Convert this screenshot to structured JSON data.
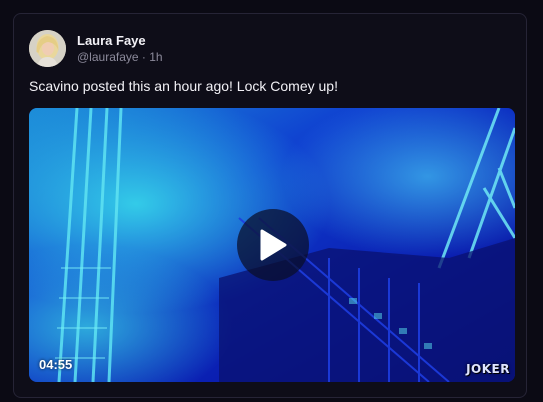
{
  "post": {
    "author": {
      "display_name": "Laura Faye",
      "handle": "@laurafaye",
      "separator": "·",
      "time": "1h"
    },
    "text": "Scavino posted this an hour ago! Lock Comey up!",
    "video": {
      "duration": "04:55",
      "watermark": "JOKER",
      "play_icon": "play-icon"
    }
  },
  "colors": {
    "page_background": "#0b0a14",
    "card_background": "#0e0d18",
    "card_border": "#262436",
    "text_primary": "#f2f1f6",
    "text_secondary": "#8c8a9b",
    "video_blue": "#0a1fa8",
    "video_cyan": "#2fd6e6"
  }
}
